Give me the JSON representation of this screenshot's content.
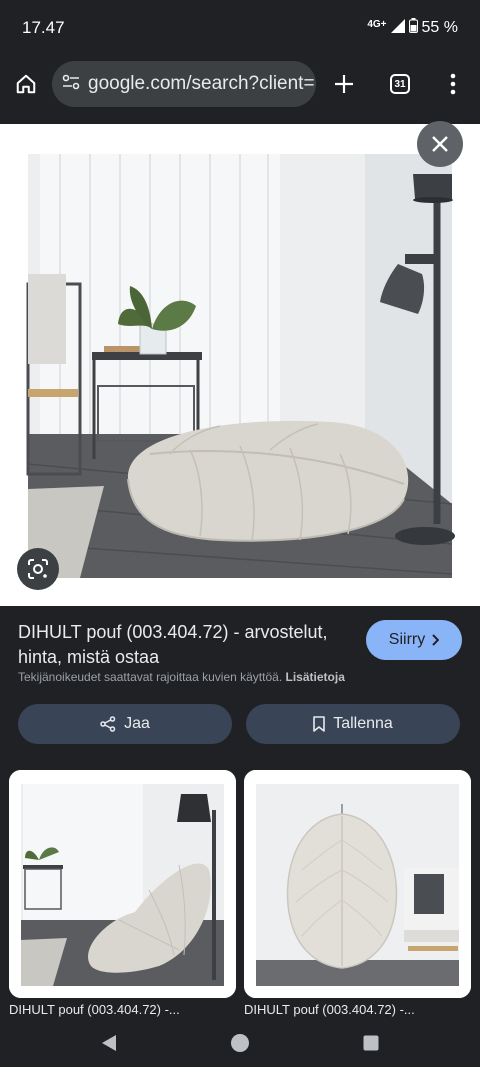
{
  "status": {
    "time": "17.47",
    "network": "4G+",
    "battery": "55 %"
  },
  "toolbar": {
    "url": "google.com/search?client=",
    "tab_count": "31"
  },
  "result": {
    "title": "DIHULT pouf (003.404.72) - arvostelut, hinta, mistä ostaa",
    "visit_label": "Siirry",
    "copyright_text": "Tekijänoikeudet saattavat rajoittaa kuvien käyttöä.",
    "copyright_link": "Lisätietoja",
    "share_label": "Jaa",
    "save_label": "Tallenna"
  },
  "related": [
    {
      "caption": "DIHULT pouf (003.404.72) -..."
    },
    {
      "caption": "DIHULT pouf (003.404.72) -..."
    }
  ],
  "icons": {
    "home": "home-icon",
    "site_settings": "tune-icon",
    "new_tab": "plus-icon",
    "tabs": "tab-switcher-icon",
    "menu": "more-vert-icon",
    "close": "close-icon",
    "lens": "lens-icon",
    "share": "share-icon",
    "bookmark": "bookmark-icon",
    "back": "back-icon",
    "home_nav": "home-circle-icon",
    "recents": "recents-icon"
  },
  "colors": {
    "background": "#202124",
    "accent": "#8ab4f8",
    "button": "#394457"
  }
}
